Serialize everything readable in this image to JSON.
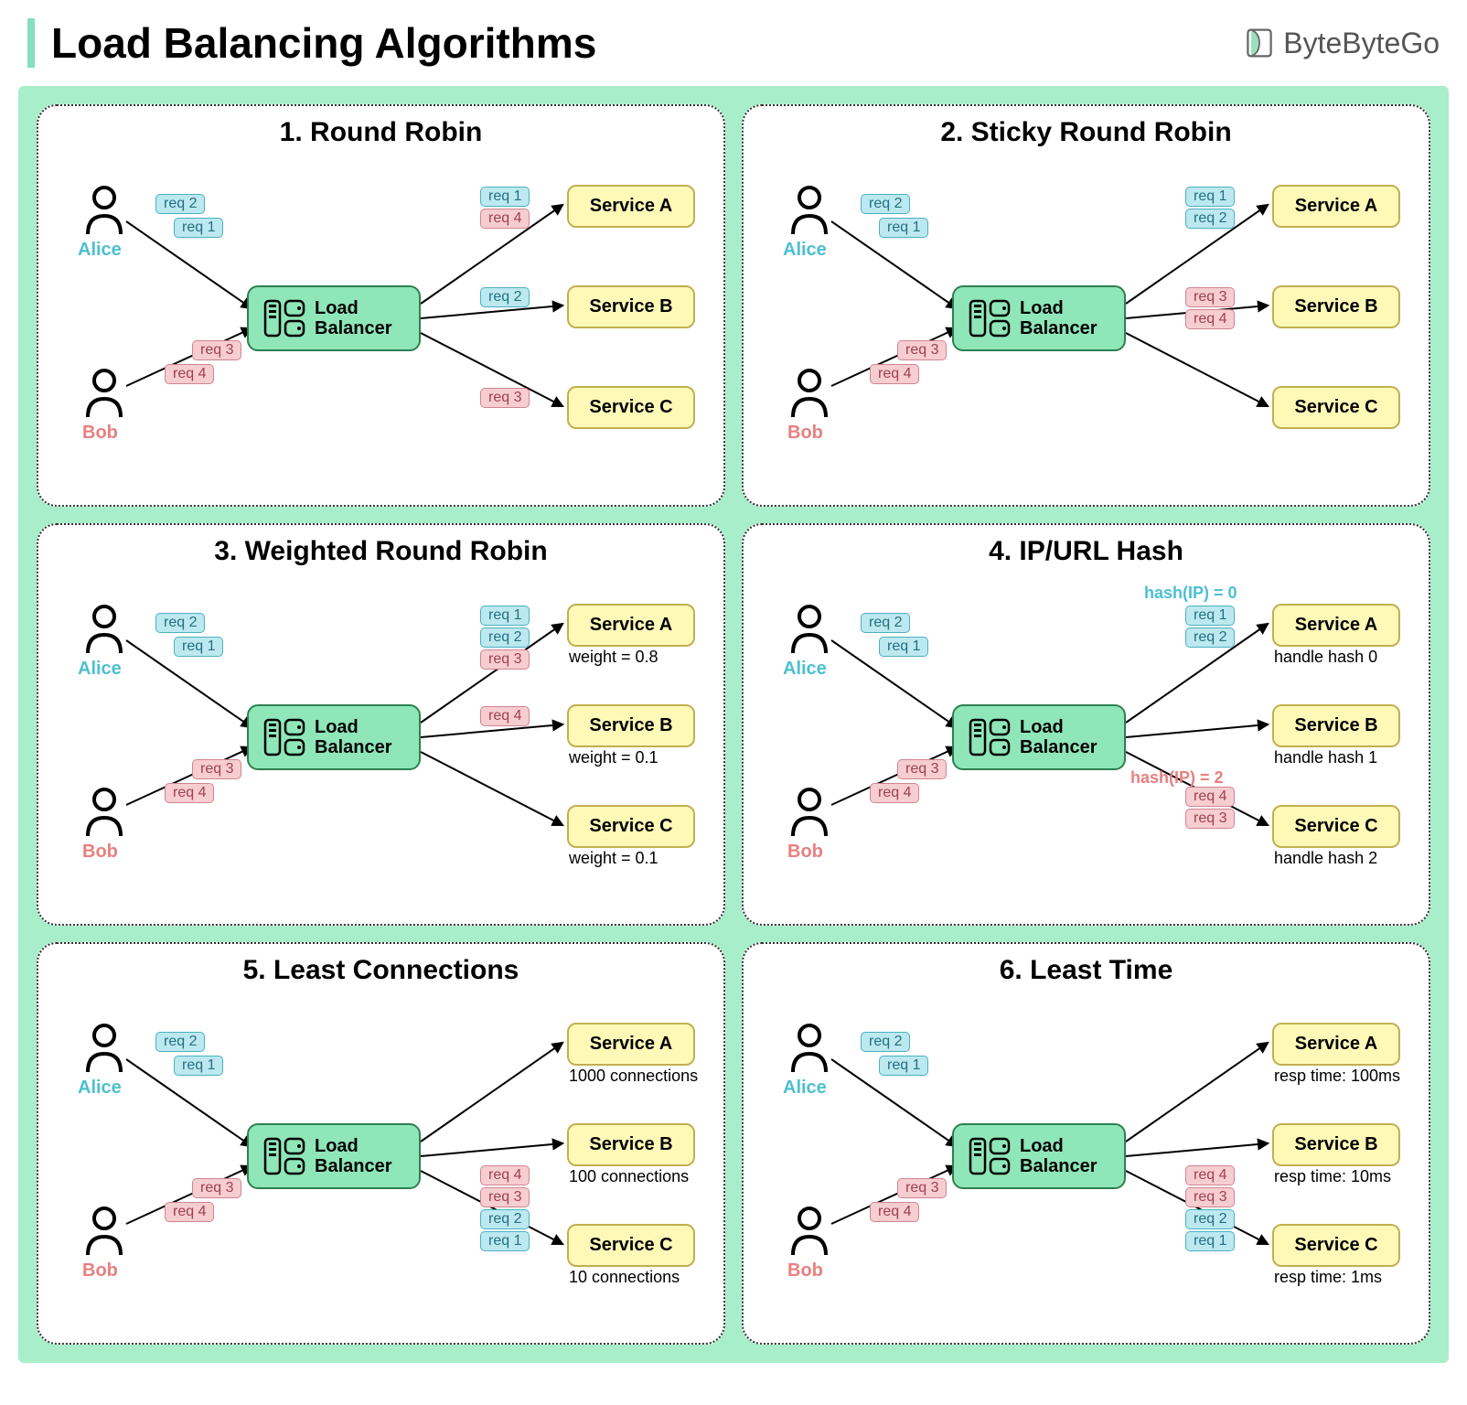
{
  "header": {
    "title": "Load Balancing Algorithms",
    "brand": "ByteByteGo"
  },
  "users": {
    "alice": "Alice",
    "bob": "Bob"
  },
  "lb": {
    "label": "Load Balancer"
  },
  "services": {
    "a": "Service A",
    "b": "Service B",
    "c": "Service C"
  },
  "reqs": {
    "r1": "req 1",
    "r2": "req 2",
    "r3": "req 3",
    "r4": "req 4"
  },
  "algorithms": [
    {
      "title": "1. Round Robin",
      "routes": {
        "a": [
          "req 1",
          "req 4"
        ],
        "b": [
          "req 2"
        ],
        "c": [
          "req 3"
        ]
      },
      "route_colors": {
        "a": [
          "blue",
          "pink"
        ],
        "b": [
          "blue"
        ],
        "c": [
          "pink"
        ]
      }
    },
    {
      "title": "2. Sticky Round Robin",
      "routes": {
        "a": [
          "req 1",
          "req 2"
        ],
        "b": [
          "req 3",
          "req 4"
        ],
        "c": []
      },
      "route_colors": {
        "a": [
          "blue",
          "blue"
        ],
        "b": [
          "pink",
          "pink"
        ],
        "c": []
      }
    },
    {
      "title": "3. Weighted Round Robin",
      "routes": {
        "a": [
          "req 1",
          "req 2",
          "req 3"
        ],
        "b": [
          "req 4"
        ],
        "c": []
      },
      "route_colors": {
        "a": [
          "blue",
          "blue",
          "pink"
        ],
        "b": [
          "pink"
        ],
        "c": []
      },
      "notes": {
        "a": "weight = 0.8",
        "b": "weight = 0.1",
        "c": "weight = 0.1"
      }
    },
    {
      "title": "4. IP/URL Hash",
      "routes": {
        "a": [
          "req 1",
          "req 2"
        ],
        "b": [],
        "c": [
          "req 4",
          "req 3"
        ]
      },
      "route_colors": {
        "a": [
          "blue",
          "blue"
        ],
        "b": [],
        "c": [
          "pink",
          "pink"
        ]
      },
      "hash_labels": {
        "alice": "hash(IP) = 0",
        "bob": "hash(IP) = 2"
      },
      "notes": {
        "a": "handle hash 0",
        "b": "handle hash 1",
        "c": "handle hash 2"
      }
    },
    {
      "title": "5. Least Connections",
      "routes": {
        "a": [],
        "b": [],
        "c": [
          "req 4",
          "req 3",
          "req 2",
          "req 1"
        ]
      },
      "route_colors": {
        "a": [],
        "b": [],
        "c": [
          "pink",
          "pink",
          "blue",
          "blue"
        ]
      },
      "notes": {
        "a": "1000 connections",
        "b": "100 connections",
        "c": "10 connections"
      }
    },
    {
      "title": "6. Least Time",
      "routes": {
        "a": [],
        "b": [],
        "c": [
          "req 4",
          "req 3",
          "req 2",
          "req 1"
        ]
      },
      "route_colors": {
        "a": [],
        "b": [],
        "c": [
          "pink",
          "pink",
          "blue",
          "blue"
        ]
      },
      "notes": {
        "a": "resp time: 100ms",
        "b": "resp time: 10ms",
        "c": "resp time: 1ms"
      }
    }
  ]
}
